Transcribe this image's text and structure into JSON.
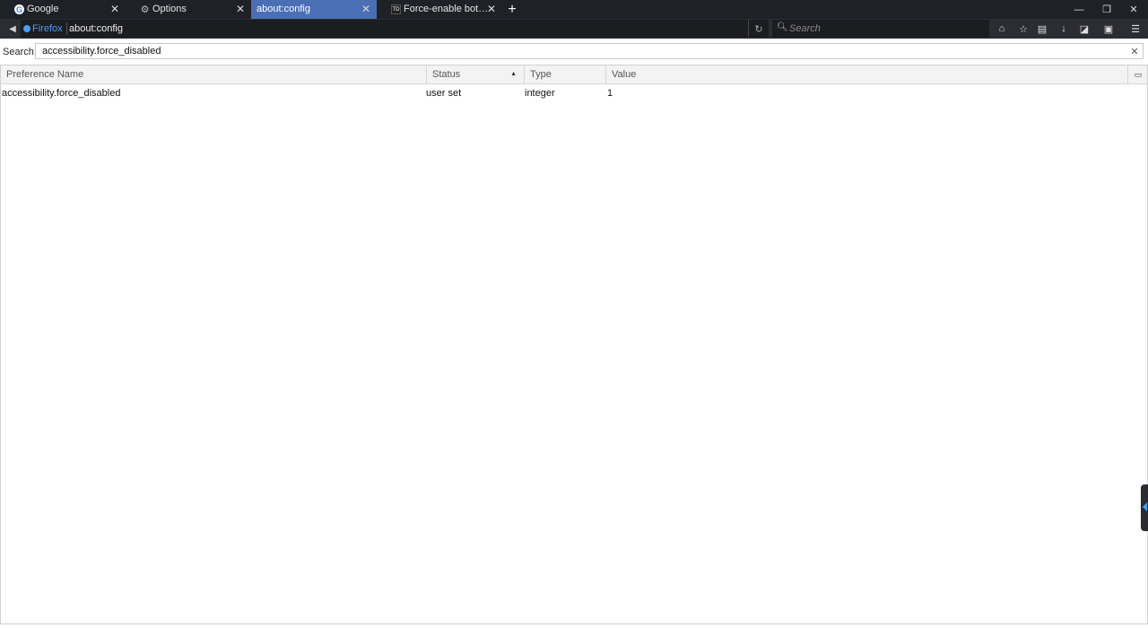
{
  "tabs": [
    {
      "label": "Google",
      "icon": "google-icon",
      "active": false
    },
    {
      "label": "Options",
      "icon": "gear-icon",
      "active": false
    },
    {
      "label": "about:config",
      "icon": "",
      "active": true
    },
    {
      "label": "Force-enable both E…",
      "icon": "td-icon",
      "active": false
    }
  ],
  "toolbar": {
    "identity_label": "Firefox",
    "url": "about:config",
    "search_placeholder": "Search"
  },
  "config": {
    "search_label": "Search:",
    "search_value": "accessibility.force_disabled",
    "columns": {
      "name": "Preference Name",
      "status": "Status",
      "type": "Type",
      "value": "Value"
    },
    "rows": [
      {
        "name": "accessibility.force_disabled",
        "status": "user set",
        "type": "integer",
        "value": "1"
      }
    ]
  },
  "colors": {
    "active_tab": "#4a6fb5",
    "chrome_dark": "#1f2126",
    "firefox_blue": "#49a0f5"
  }
}
